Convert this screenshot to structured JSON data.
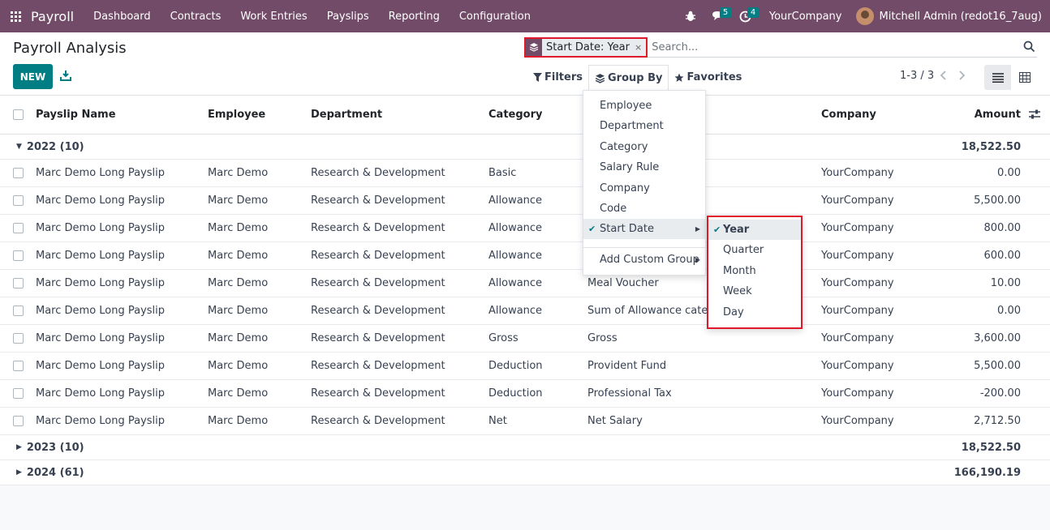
{
  "navbar": {
    "brand": "Payroll",
    "menu": [
      "Dashboard",
      "Contracts",
      "Work Entries",
      "Payslips",
      "Reporting",
      "Configuration"
    ],
    "messages_count": "5",
    "activities_count": "4",
    "company": "YourCompany",
    "user": "Mitchell Admin (redot16_7aug)"
  },
  "control": {
    "title": "Payroll Analysis",
    "new_label": "NEW",
    "facet": "Start Date: Year",
    "facet_remove": "×",
    "search_placeholder": "Search...",
    "filters_label": "Filters",
    "groupby_label": "Group By",
    "favorites_label": "Favorites",
    "pager": "1-3 / 3"
  },
  "table": {
    "columns": [
      "Payslip Name",
      "Employee",
      "Department",
      "Category",
      "Company",
      "Amount"
    ],
    "groups": [
      {
        "label": "2022 (10)",
        "amount": "18,522.50",
        "expanded": true
      },
      {
        "label": "2023 (10)",
        "amount": "18,522.50",
        "expanded": false
      },
      {
        "label": "2024 (61)",
        "amount": "166,190.19",
        "expanded": false
      }
    ],
    "rows": [
      {
        "name": "Marc Demo Long Payslip",
        "employee": "Marc Demo",
        "department": "Research & Development",
        "category": "Basic",
        "rule": "",
        "company": "YourCompany",
        "amount": "0.00"
      },
      {
        "name": "Marc Demo Long Payslip",
        "employee": "Marc Demo",
        "department": "Research & Development",
        "category": "Allowance",
        "rule": "",
        "company": "YourCompany",
        "amount": "5,500.00"
      },
      {
        "name": "Marc Demo Long Payslip",
        "employee": "Marc Demo",
        "department": "Research & Development",
        "category": "Allowance",
        "rule": "",
        "company": "YourCompany",
        "amount": "800.00"
      },
      {
        "name": "Marc Demo Long Payslip",
        "employee": "Marc Demo",
        "department": "Research & Development",
        "category": "Allowance",
        "rule": "",
        "company": "YourCompany",
        "amount": "600.00"
      },
      {
        "name": "Marc Demo Long Payslip",
        "employee": "Marc Demo",
        "department": "Research & Development",
        "category": "Allowance",
        "rule": "Meal Voucher",
        "company": "YourCompany",
        "amount": "10.00"
      },
      {
        "name": "Marc Demo Long Payslip",
        "employee": "Marc Demo",
        "department": "Research & Development",
        "category": "Allowance",
        "rule": "Sum of Allowance catego",
        "company": "YourCompany",
        "amount": "0.00"
      },
      {
        "name": "Marc Demo Long Payslip",
        "employee": "Marc Demo",
        "department": "Research & Development",
        "category": "Gross",
        "rule": "Gross",
        "company": "YourCompany",
        "amount": "3,600.00"
      },
      {
        "name": "Marc Demo Long Payslip",
        "employee": "Marc Demo",
        "department": "Research & Development",
        "category": "Deduction",
        "rule": "Provident Fund",
        "company": "YourCompany",
        "amount": "5,500.00"
      },
      {
        "name": "Marc Demo Long Payslip",
        "employee": "Marc Demo",
        "department": "Research & Development",
        "category": "Deduction",
        "rule": "Professional Tax",
        "company": "YourCompany",
        "amount": "-200.00"
      },
      {
        "name": "Marc Demo Long Payslip",
        "employee": "Marc Demo",
        "department": "Research & Development",
        "category": "Net",
        "rule": "Net Salary",
        "company": "YourCompany",
        "amount": "2,712.50"
      }
    ]
  },
  "groupby_menu": {
    "items": [
      "Employee",
      "Department",
      "Category",
      "Salary Rule",
      "Company",
      "Code",
      "Start Date"
    ],
    "custom_group": "Add Custom Group",
    "submenu": [
      "Year",
      "Quarter",
      "Month",
      "Week",
      "Day"
    ]
  },
  "colors": {
    "navbar": "#714b67",
    "primary": "#017e84",
    "highlight": "#e0182b"
  }
}
